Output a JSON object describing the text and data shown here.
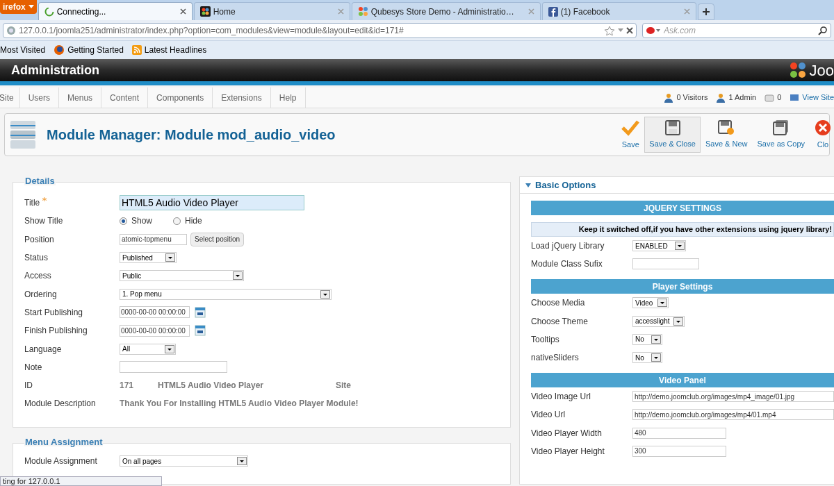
{
  "browser": {
    "app_button": "irefox",
    "tabs": [
      {
        "label": "Connecting...",
        "selected": true,
        "kind": "loading"
      },
      {
        "label": "Home",
        "selected": false,
        "kind": "site"
      },
      {
        "label": "Qubesys Store Demo - Administratio…",
        "selected": false,
        "kind": "admin"
      },
      {
        "label": "(1) Facebook",
        "selected": false,
        "kind": "social"
      }
    ],
    "address": "127.0.0.1/joomla251/administrator/index.php?option=com_modules&view=module&layout=edit&id=171#",
    "search": {
      "placeholder": "Ask.com"
    },
    "bookmarks": [
      "Most Visited",
      "Getting Started",
      "Latest Headlines"
    ],
    "status_popup": "ting for 127.0.0.1"
  },
  "header": {
    "title": "Administration",
    "logo": "Joo"
  },
  "menu": [
    "Site",
    "Users",
    "Menus",
    "Content",
    "Components",
    "Extensions",
    "Help"
  ],
  "status_items": [
    {
      "label": "0 Visitors",
      "kind": "visitors"
    },
    {
      "label": "1 Admin",
      "kind": "admin"
    },
    {
      "label": "0",
      "kind": "messages"
    },
    {
      "label": "View Site",
      "kind": "view"
    }
  ],
  "page_title": "Module Manager: Module mod_audio_video",
  "toolbar": [
    {
      "label": "Save",
      "kind": "check",
      "selected": false
    },
    {
      "label": "Save & Close",
      "kind": "disk",
      "selected": true
    },
    {
      "label": "Save & New",
      "kind": "disk-plus",
      "selected": false
    },
    {
      "label": "Save as Copy",
      "kind": "disk-copy",
      "selected": false
    },
    {
      "label": "Clo",
      "kind": "close",
      "selected": false
    }
  ],
  "details": {
    "legend": "Details",
    "fields": [
      {
        "label": "Title",
        "required": true,
        "kind": "input",
        "value": "HTML5 Audio Video Player"
      },
      {
        "label": "Show Title",
        "kind": "radio",
        "options": [
          {
            "label": "Show",
            "selected": true
          },
          {
            "label": "Hide",
            "selected": false
          }
        ]
      },
      {
        "label": "Position",
        "kind": "input_button",
        "value": "atomic-topmenu",
        "button": "Select position"
      },
      {
        "label": "Status",
        "kind": "select",
        "value": "Published"
      },
      {
        "label": "Access",
        "kind": "select",
        "value": "Public"
      },
      {
        "label": "Ordering",
        "kind": "select",
        "value": "1. Pop menu"
      },
      {
        "label": "Start Publishing",
        "kind": "date",
        "value": "0000-00-00 00:00:00"
      },
      {
        "label": "Finish Publishing",
        "kind": "date",
        "value": "0000-00-00 00:00:00"
      },
      {
        "label": "Language",
        "kind": "select",
        "value": "All"
      },
      {
        "label": "Note",
        "kind": "input"
      },
      {
        "label": "ID",
        "kind": "static",
        "parts": [
          "171",
          "HTML5 Audio Video Player",
          "Site"
        ]
      },
      {
        "label": "Module Description",
        "kind": "static",
        "parts": [
          "Thank You For Installing HTML5 Audio Video Player Module!"
        ]
      }
    ]
  },
  "menu_assignment": {
    "legend": "Menu Assignment",
    "label": "Module Assignment",
    "value": "On all pages"
  },
  "basic_options": {
    "title": "Basic Options",
    "expanded": true,
    "rows": [
      {
        "kind": "header",
        "label": "JQUERY SETTINGS"
      },
      {
        "kind": "notice",
        "label": "Keep it switched off,if you have other extensions using jquery library!"
      },
      {
        "kind": "select",
        "label": "Load jQuery Library",
        "value": "ENABLED"
      },
      {
        "kind": "input",
        "label": "Module Class Sufix"
      },
      {
        "kind": "header",
        "label": "Player Settings"
      },
      {
        "kind": "select",
        "label": "Choose Media",
        "value": "Video"
      },
      {
        "kind": "select",
        "label": "Choose Theme",
        "value": "accesslight"
      },
      {
        "kind": "select",
        "label": "Tooltips",
        "value": "No"
      },
      {
        "kind": "select",
        "label": "nativeSliders",
        "value": "No"
      },
      {
        "kind": "header",
        "label": "Video Panel"
      },
      {
        "kind": "url",
        "label": "Video Image Url",
        "value": "http://demo.joomclub.org/images/mp4_image/01.jpg"
      },
      {
        "kind": "url",
        "label": "Video Url",
        "value": "http://demo.joomclub.org/images/mp4/01.mp4"
      },
      {
        "kind": "input",
        "label": "Video Player Width",
        "value": "480"
      },
      {
        "kind": "input",
        "label": "Video Player Height",
        "value": "300"
      }
    ]
  }
}
